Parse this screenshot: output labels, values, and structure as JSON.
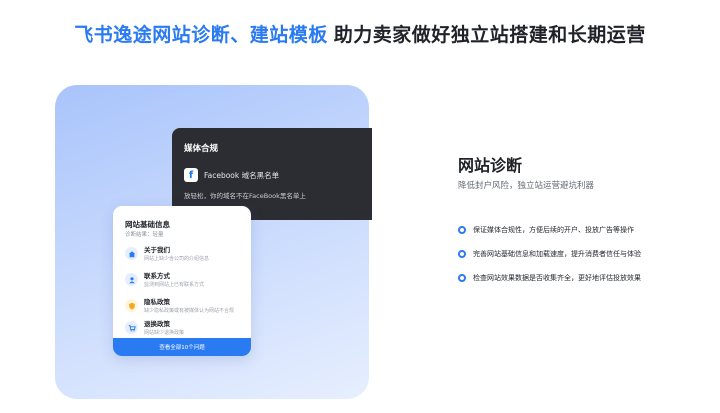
{
  "headline": {
    "highlight": "飞书逸途网站诊断、建站模板",
    "rest": "助力卖家做好独立站搭建和长期运营"
  },
  "compliance_card": {
    "title": "媒体合规",
    "icon": "facebook-icon",
    "label": "Facebook 域名黑名单",
    "description": "放轻松，你的域名不在FaceBook黑名单上"
  },
  "info_card": {
    "title": "网站基础信息",
    "subtitle": "诊断结果：轻量",
    "items": [
      {
        "icon": "home-icon",
        "title": "关于我们",
        "desc": "网站上缺少含公司的介绍信息"
      },
      {
        "icon": "contact-icon",
        "title": "联系方式",
        "desc": "监测到网站上已有联系方式"
      },
      {
        "icon": "shield-icon",
        "title": "隐私政策",
        "desc": "缺少隐私政策或有被媒体认为网站不合规"
      },
      {
        "icon": "cart-icon",
        "title": "退换政策",
        "desc": "网站缺少退换政策"
      }
    ],
    "button_label": "查看全部10个问题"
  },
  "section": {
    "title": "网站诊断",
    "subtitle": "降低封户风险，独立站运营避坑利器"
  },
  "features": [
    "保证媒体合规性，方便后续的开户、投放广告等操作",
    "完善网站基础信息和加载速度，提升消费者信任与体验",
    "检查网站效果数据是否收集齐全，更好地评估投放效果"
  ],
  "colors": {
    "accent": "#2a7af2",
    "dark_card": "#2b2d32",
    "showcase_gradient_start": "#a9c4fb",
    "showcase_gradient_end": "#e7effe"
  }
}
